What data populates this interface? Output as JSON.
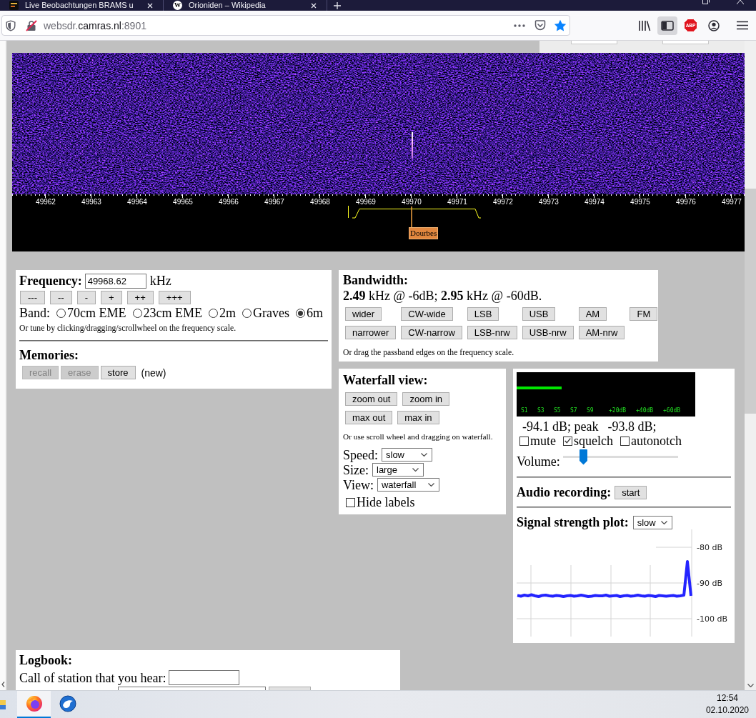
{
  "browser": {
    "tabs": [
      {
        "title": "Live Beobachtungen BRAMS u",
        "icon": {
          "kind": "tile"
        }
      },
      {
        "title": "Orioniden – Wikipedia",
        "icon": {
          "kind": "letter",
          "text": "W"
        }
      }
    ],
    "address": "websdr.**camras.nl**:8901",
    "sidebar_open": true,
    "extension_badge": "ABP"
  },
  "waterfall": {
    "scale_labels": [
      "49962",
      "49963",
      "49964",
      "49965",
      "49966",
      "49967",
      "49968",
      "49969",
      "49970",
      "49971",
      "49972",
      "49973",
      "49974",
      "49975",
      "49976",
      "49977"
    ],
    "station_label": "Dourbes"
  },
  "frequency": {
    "heading": "Frequency:",
    "value": "49968.62",
    "unit": "kHz",
    "step_buttons": [
      "---",
      "--",
      "-",
      "+",
      "++",
      "+++"
    ],
    "band_label": "Band:",
    "bands": [
      {
        "label": "70cm EME",
        "selected": false
      },
      {
        "label": "23cm EME",
        "selected": false
      },
      {
        "label": "2m",
        "selected": false
      },
      {
        "label": "Graves",
        "selected": false
      },
      {
        "label": "6m",
        "selected": true
      }
    ],
    "hint": "Or tune by clicking/dragging/scrollwheel on the frequency scale."
  },
  "memories": {
    "heading": "Memories:",
    "buttons": [
      {
        "label": "recall",
        "disabled": true
      },
      {
        "label": "erase",
        "disabled": true
      },
      {
        "label": "store",
        "disabled": false
      }
    ],
    "status": "(new)"
  },
  "bandwidth": {
    "heading": "Bandwidth:",
    "summary": "**2.49** kHz @ -6dB; **2.95** kHz @ -60dB.",
    "buttons": [
      [
        "wider",
        "CW-wide",
        "LSB",
        "USB",
        "AM",
        "FM"
      ],
      [
        "narrower",
        "CW-narrow",
        "LSB-nrw",
        "USB-nrw",
        "AM-nrw"
      ]
    ],
    "hint": "Or drag the passband edges on the frequency scale."
  },
  "waterfall_view": {
    "heading": "Waterfall view:",
    "buttons": [
      [
        "zoom out",
        "zoom in"
      ],
      [
        "max out",
        "max in"
      ]
    ],
    "hint": "Or use scroll wheel and dragging on waterfall.",
    "selects": [
      {
        "label": "Speed:",
        "value": "slow"
      },
      {
        "label": "Size:",
        "value": "large"
      },
      {
        "label": "View:",
        "value": "waterfall"
      }
    ],
    "hide_labels": {
      "label": "Hide labels",
      "checked": false
    }
  },
  "audio": {
    "smeter": {
      "level": 0.25,
      "scale": [
        [
          "S1",
          "S3",
          "S5",
          "S7",
          "S9"
        ],
        [
          "+20dB",
          "+40dB",
          "+60dB"
        ]
      ]
    },
    "level_reading": "-94.1 dB; peak",
    "peak_reading": "-93.8 dB;",
    "options": [
      {
        "label": "mute",
        "checked": false
      },
      {
        "label": "squelch",
        "checked": true
      },
      {
        "label": "autonotch",
        "checked": false
      }
    ],
    "volume": {
      "label": "Volume:",
      "level": 0.18
    },
    "recording": {
      "heading": "Audio recording:",
      "button": "start"
    },
    "plot": {
      "heading": "Signal strength plot:",
      "speed": "slow",
      "chart_data": {
        "type": "line",
        "ylim": [
          -105,
          -75
        ],
        "yticks": [
          {
            "value": -80,
            "label": "-80 dB"
          },
          {
            "value": -90,
            "label": "-90 dB"
          },
          {
            "value": -100,
            "label": "-100 dB"
          }
        ],
        "series": [
          {
            "color": "#2424ff",
            "values": [
              -93.5,
              -93.7,
              -93.4,
              -93.6,
              -93.3,
              -93.6,
              -93.8,
              -93.5,
              -93.4,
              -93.6,
              -93.7,
              -93.5,
              -93.6,
              -93.8,
              -93.6,
              -93.5,
              -93.7,
              -93.6,
              -93.4,
              -93.6,
              -93.8,
              -93.7,
              -93.5,
              -93.6,
              -93.6,
              -93.4,
              -93.7,
              -93.6,
              -93.5,
              -93.8,
              -93.6,
              -93.5,
              -93.7,
              -93.6,
              -93.4,
              -93.6,
              -93.7,
              -93.5,
              -93.6,
              -93.8,
              -93.5,
              -93.6,
              -93.7,
              -93.6,
              -93.5,
              -93.7,
              -93.6,
              -93.4,
              -84.0,
              -93.6
            ]
          }
        ]
      }
    }
  },
  "logbook": {
    "heading": "Logbook:",
    "call_label": "Call of station that you hear:"
  },
  "taskbar": {
    "apps": [
      {
        "kind": "browser",
        "active": true
      },
      {
        "kind": "mail",
        "active": false
      }
    ],
    "time": "12:54",
    "date": "02.10.2020"
  }
}
